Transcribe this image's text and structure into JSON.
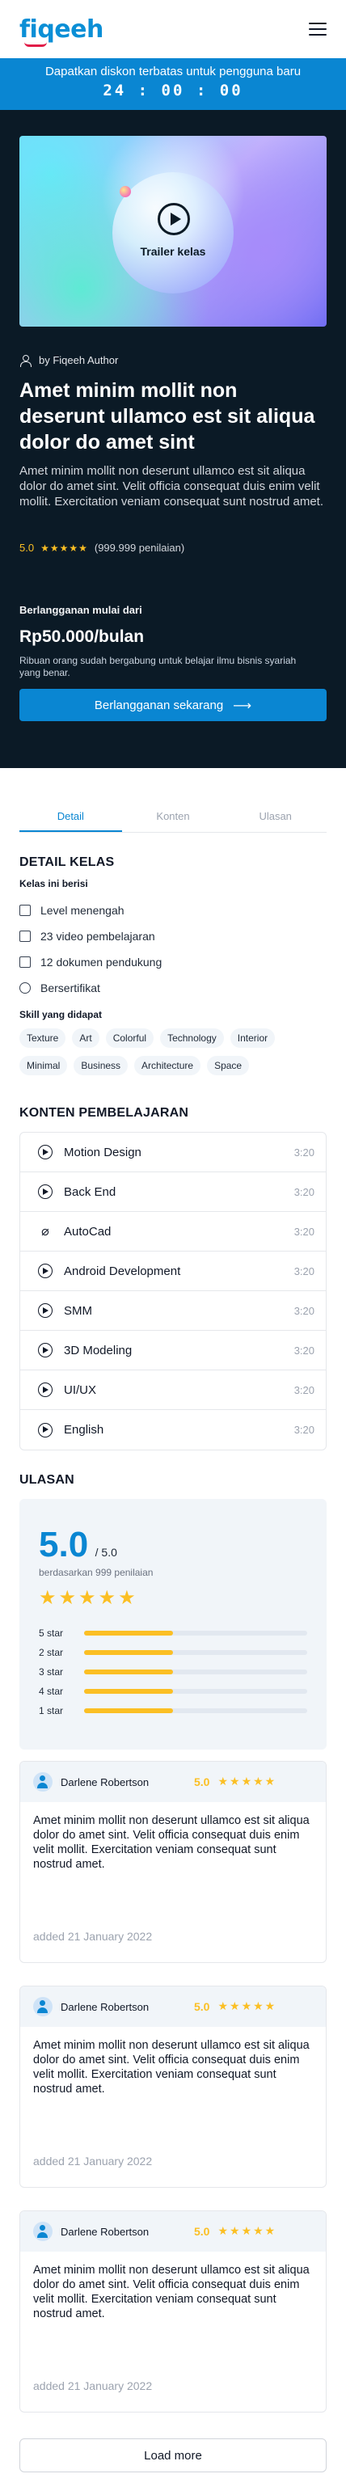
{
  "header": {
    "logo": "fiqeeh",
    "menu_icon": "hamburger-menu-icon"
  },
  "promo": {
    "text": "Dapatkan diskon terbatas untuk pengguna baru",
    "timer": "24 : 00 : 00"
  },
  "hero": {
    "trailer_label": "Trailer kelas",
    "author": "by Fiqeeh Author",
    "title": "Amet minim mollit non deserunt ullamco est sit aliqua dolor do amet sint",
    "description": "Amet minim mollit non deserunt ullamco est sit aliqua dolor do amet sint. Velit officia consequat duis enim velit mollit. Exercitation veniam consequat sunt nostrud amet.",
    "rating": "5.0",
    "stars": "★★★★★",
    "rating_count": "(999.999 penilaian)",
    "subscribe_label": "Berlangganan mulai dari",
    "price": "Rp50.000/bulan",
    "subscribe_note": "Ribuan orang sudah bergabung untuk belajar ilmu bisnis syariah yang benar.",
    "subscribe_button": "Berlangganan sekarang",
    "accent_color": "#0a86d2"
  },
  "tabs": [
    "Detail",
    "Konten",
    "Ulasan"
  ],
  "detail": {
    "title": "DETAIL KELAS",
    "includes_title": "Kelas ini berisi",
    "features": [
      {
        "icon": "book-icon",
        "label": "Level menengah"
      },
      {
        "icon": "video-icon",
        "label": "23 video pembelajaran"
      },
      {
        "icon": "document-icon",
        "label": "12 dokumen pendukung"
      },
      {
        "icon": "certificate-icon",
        "label": "Bersertifikat"
      }
    ],
    "skills_title": "Skill yang didapat",
    "skills": [
      "Texture",
      "Art",
      "Colorful",
      "Technology",
      "Interior",
      "Minimal",
      "Business",
      "Architecture",
      "Space"
    ]
  },
  "content": {
    "title": "KONTEN PEMBELAJARAN",
    "lessons": [
      {
        "icon": "play-icon",
        "title": "Motion Design",
        "duration": "3:20"
      },
      {
        "icon": "play-icon",
        "title": "Back End",
        "duration": "3:20"
      },
      {
        "icon": "paperclip-icon",
        "title": "AutoCad",
        "duration": "3:20"
      },
      {
        "icon": "play-icon",
        "title": "Android Development",
        "duration": "3:20"
      },
      {
        "icon": "play-icon",
        "title": "SMM",
        "duration": "3:20"
      },
      {
        "icon": "play-icon",
        "title": "3D Modeling",
        "duration": "3:20"
      },
      {
        "icon": "play-icon",
        "title": "UI/UX",
        "duration": "3:20"
      },
      {
        "icon": "play-icon",
        "title": "English",
        "duration": "3:20"
      }
    ]
  },
  "reviews": {
    "title": "ULASAN",
    "score": "5.0",
    "score_out_of": "/ 5.0",
    "based_on": "berdasarkan 999 penilaian",
    "stars": "★★★★★",
    "distribution": [
      {
        "label": "5 star",
        "fraction": 0.4
      },
      {
        "label": "2 star",
        "fraction": 0.4
      },
      {
        "label": "3 star",
        "fraction": 0.4
      },
      {
        "label": "4 star",
        "fraction": 0.4
      },
      {
        "label": "1 star",
        "fraction": 0.4
      }
    ],
    "items": [
      {
        "name": "Darlene Robertson",
        "score": "5.0",
        "stars": "★★★★★",
        "text": "Amet minim mollit non deserunt ullamco est sit aliqua dolor do amet sint. Velit officia consequat duis enim velit mollit. Exercitation veniam consequat sunt nostrud amet.",
        "date": "added 21 January 2022"
      },
      {
        "name": "Darlene Robertson",
        "score": "5.0",
        "stars": "★★★★★",
        "text": "Amet minim mollit non deserunt ullamco est sit aliqua dolor do amet sint. Velit officia consequat duis enim velit mollit. Exercitation veniam consequat sunt nostrud amet.",
        "date": "added 21 January 2022"
      },
      {
        "name": "Darlene Robertson",
        "score": "5.0",
        "stars": "★★★★★",
        "text": "Amet minim mollit non deserunt ullamco est sit aliqua dolor do amet sint. Velit officia consequat duis enim velit mollit. Exercitation veniam consequat sunt nostrud amet.",
        "date": "added 21 January 2022"
      }
    ],
    "load_more": "Load more",
    "star_color": "#fbbf24"
  }
}
